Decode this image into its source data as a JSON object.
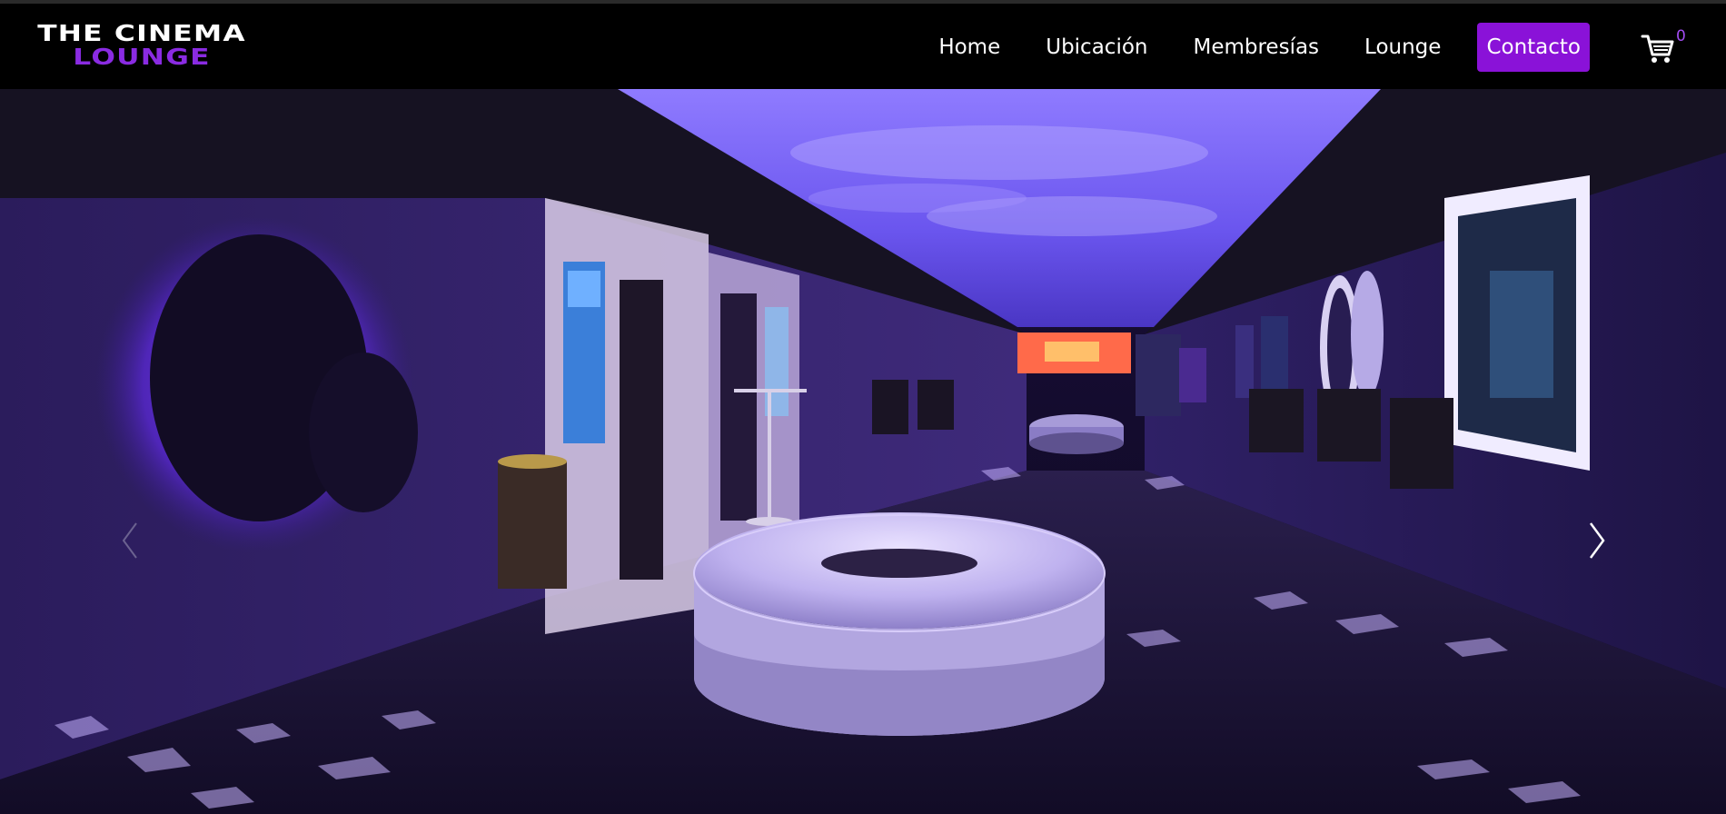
{
  "brand": {
    "line1": "THE CINEMA",
    "line2": "LOUNGE",
    "accent_color": "#8a2be2"
  },
  "nav": {
    "items": [
      "Home",
      "Ubicación",
      "Membresías",
      "Lounge"
    ],
    "cta": "Contacto",
    "cta_color": "#8a12d8"
  },
  "cart": {
    "icon": "shopping-cart-icon",
    "count": "0"
  },
  "hero": {
    "prev_icon": "chevron-left-icon",
    "next_icon": "chevron-right-icon"
  }
}
